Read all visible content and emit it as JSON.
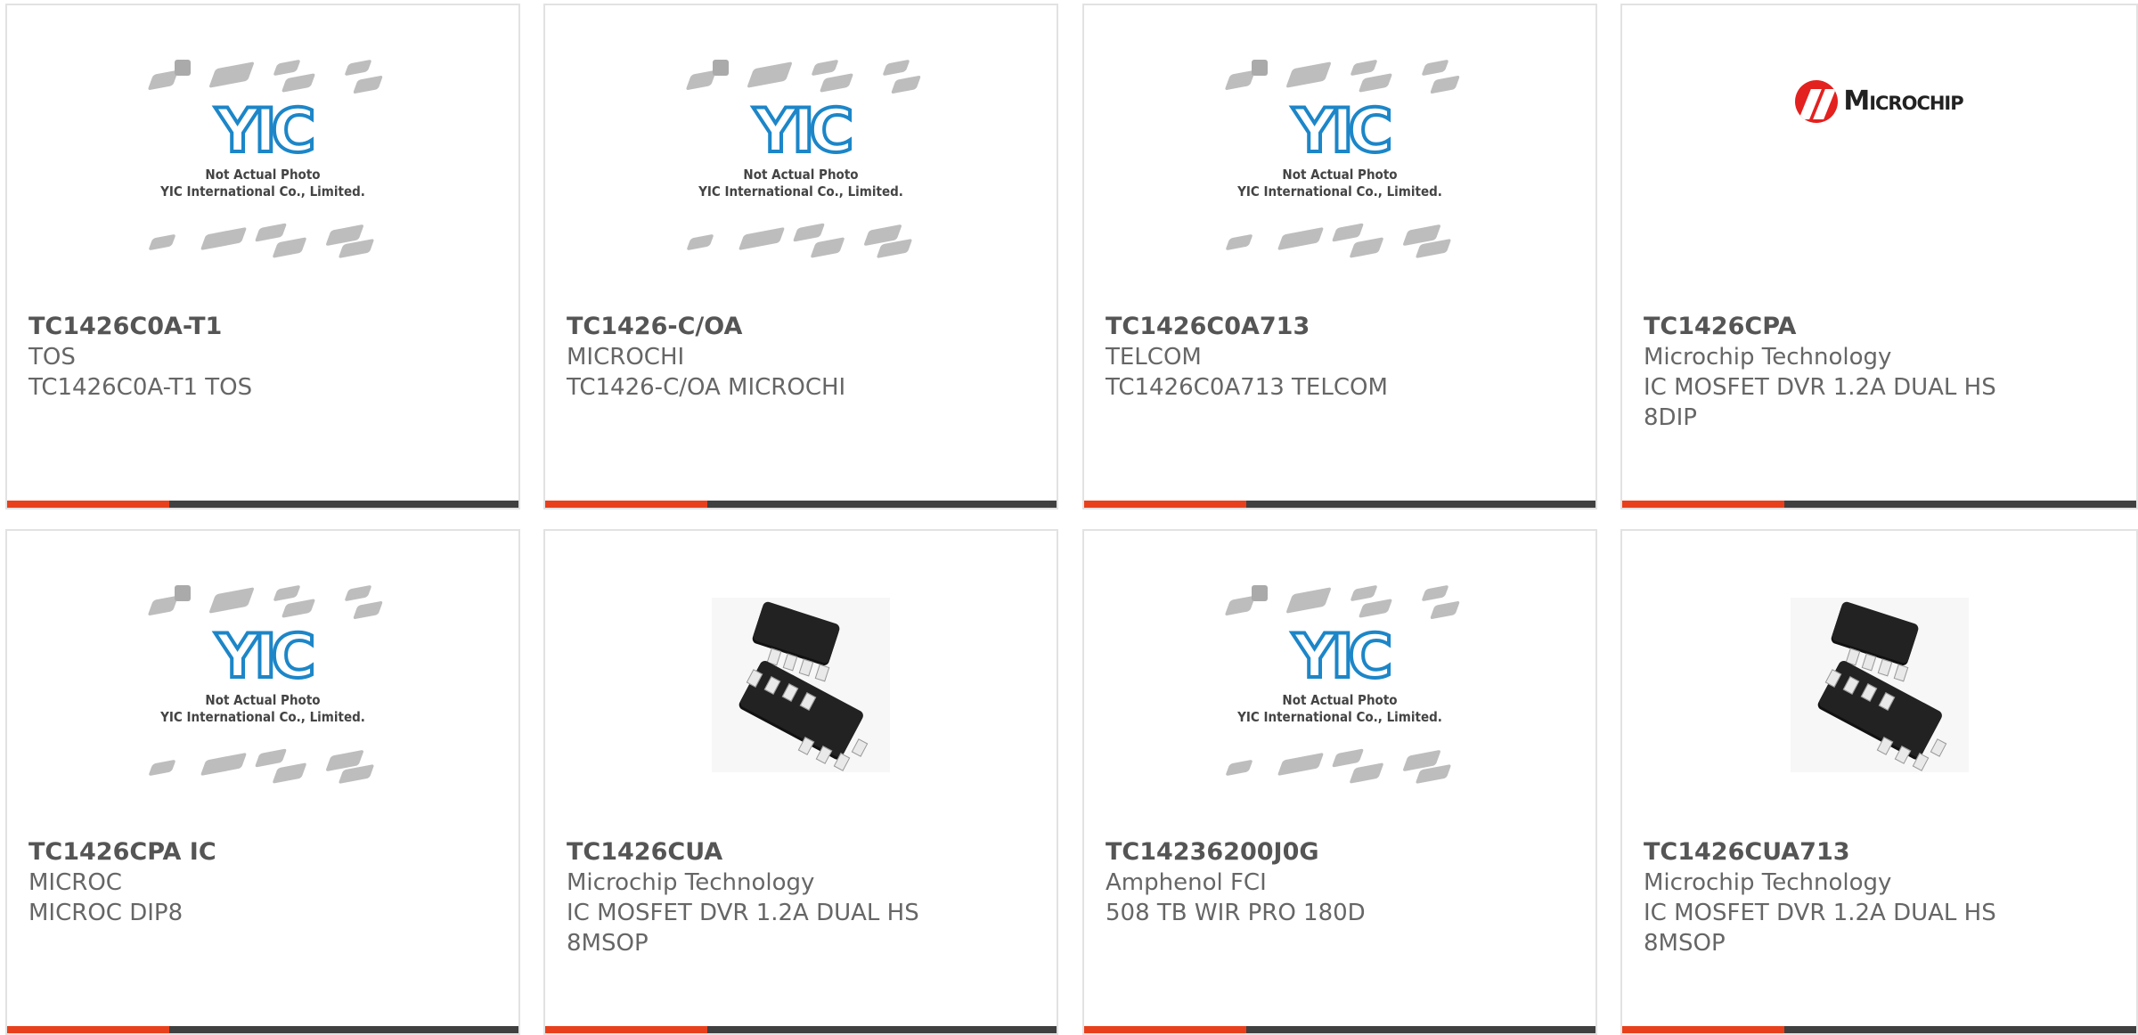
{
  "cards": [
    {
      "part": "TC1426C0A-T1",
      "mfr": "TOS",
      "desc": "TC1426C0A-T1 TOS",
      "image": "yic-placeholder"
    },
    {
      "part": "TC1426-C/OA",
      "mfr": "MICROCHI",
      "desc": "TC1426-C/OA MICROCHI",
      "image": "yic-placeholder"
    },
    {
      "part": "TC1426C0A713",
      "mfr": "TELCOM",
      "desc": "TC1426C0A713 TELCOM",
      "image": "yic-placeholder"
    },
    {
      "part": "TC1426CPA",
      "mfr": "Microchip Technology",
      "desc": "IC MOSFET DVR 1.2A DUAL HS 8DIP",
      "image": "microchip-logo"
    },
    {
      "part": "TC1426CPA IC",
      "mfr": "MICROC",
      "desc": "MICROC DIP8",
      "image": "yic-placeholder"
    },
    {
      "part": "TC1426CUA",
      "mfr": "Microchip Technology",
      "desc": "IC MOSFET DVR 1.2A DUAL HS 8MSOP",
      "image": "msop-chip"
    },
    {
      "part": "TC14236200J0G",
      "mfr": "Amphenol FCI",
      "desc": "508 TB WIR PRO 180D",
      "image": "yic-placeholder"
    },
    {
      "part": "TC1426CUA713",
      "mfr": "Microchip Technology",
      "desc": "IC MOSFET DVR 1.2A DUAL HS 8MSOP",
      "image": "msop-chip"
    }
  ],
  "placeholder": {
    "logo_text": "YIC",
    "caption_line1": "Not Actual Photo",
    "caption_line2": "YIC International Co., Limited."
  },
  "microchip_logo_text": "Microchip",
  "colors": {
    "accent": "#e8401c",
    "bar": "#404040",
    "yic_blue": "#1c86c8",
    "microchip_red": "#e3211f"
  }
}
